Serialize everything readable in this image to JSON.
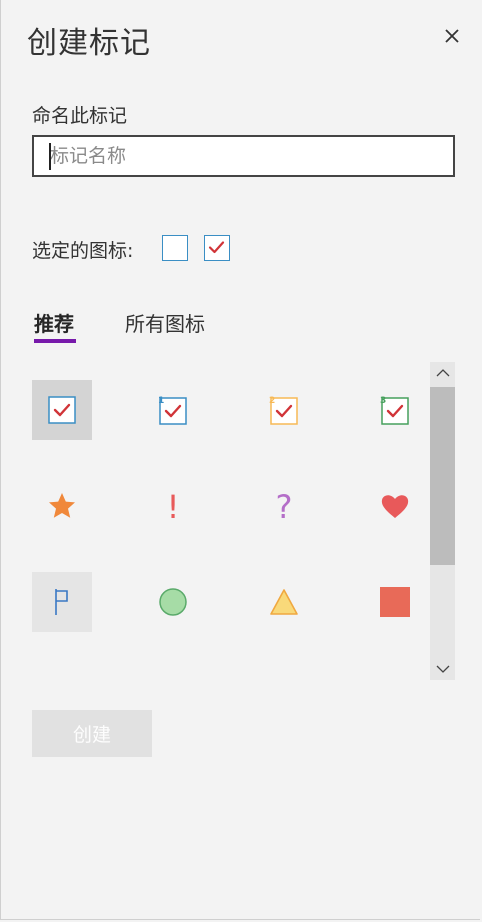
{
  "dialog": {
    "title": "创建标记",
    "close_icon": "close-icon"
  },
  "name_field": {
    "label": "命名此标记",
    "placeholder": "标记名称",
    "value": ""
  },
  "selected_icon": {
    "label": "选定的图标:",
    "icons": [
      "empty-checkbox-icon",
      "checkbox-check-icon"
    ]
  },
  "tabs": [
    {
      "label": "推荐",
      "active": true
    },
    {
      "label": "所有图标",
      "active": false
    }
  ],
  "icon_grid": [
    {
      "name": "checkbox-check-icon",
      "selected": true
    },
    {
      "name": "checkbox-check-1-icon",
      "badge": "1"
    },
    {
      "name": "checkbox-check-2-icon",
      "badge": "2"
    },
    {
      "name": "checkbox-check-3-icon",
      "badge": "3"
    },
    {
      "name": "star-icon"
    },
    {
      "name": "exclamation-icon",
      "glyph": "!"
    },
    {
      "name": "question-icon",
      "glyph": "?"
    },
    {
      "name": "heart-icon"
    },
    {
      "name": "flag-icon",
      "hover": true
    },
    {
      "name": "circle-icon"
    },
    {
      "name": "triangle-icon"
    },
    {
      "name": "square-icon"
    }
  ],
  "colors": {
    "accent": "#7719aa",
    "check_red": "#d13438",
    "box_blue": "#3a8ec4",
    "box_orange": "#f7b955",
    "box_green": "#46a05c",
    "star_orange": "#f0883a",
    "exclamation_red": "#e85a5a",
    "question_purple": "#b46ec8",
    "heart_red": "#e8595a",
    "flag_blue": "#3a78c4",
    "circle_green": "#a6dca6",
    "triangle_yellow": "#f9d97a",
    "square_red": "#e86a58"
  },
  "create_button": {
    "label": "创建",
    "enabled": false
  }
}
